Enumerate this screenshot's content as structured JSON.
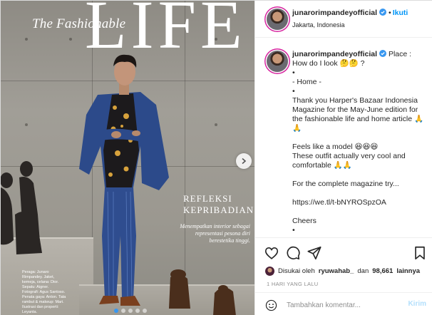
{
  "photo": {
    "magazine_script": "The Fashionable",
    "magazine_title": "LIFE",
    "feature_title": "REFLEKSI KEPRIBADIAN",
    "feature_subtitle": "Menempatkan interior sebagai representasi pesona diri berestetika tinggi.",
    "credits": "Peraga: Junaro Rimpandey. Jaket, kemeja, celana: Dior. Sepatu: Aigner. Fotografi: Agus Santoso. Penata gaya: Anton. Tata rambut & makeup: Mari. Ilustrasi dan properti: Leyanta.",
    "slide_count": 5,
    "active_slide": 1
  },
  "header": {
    "username": "junarorimpandeyofficial",
    "follow_label": "Ikuti",
    "location": "Jakarta, Indonesia",
    "separator": "•"
  },
  "caption": {
    "username": "junarorimpandeyofficial",
    "text": "Place : How do I look 🤔🤔 ?\n•\n- Home -\n•\nThank you Harper's Bazaar Indonesia Magazine for the May-June edition for the fashionable life and home article 🙏🙏\n\nFeels like a model 😆😆😆\nThese outfit actually very cool and comfortable 🙏🙏\n\nFor the complete magazine try...\n\nhttps://we.tl/t-bNYROSpzOA\n\nCheers\n•"
  },
  "engagement": {
    "liked_by_prefix": "Disukai oleh",
    "liked_by_user": "ryuwahab_",
    "liked_by_middle": "dan",
    "likes_count": "98,661",
    "liked_by_suffix": "lainnya",
    "time_ago": "1 HARI YANG LALU"
  },
  "comment": {
    "placeholder": "Tambahkan komentar...",
    "send_label": "Kirim"
  },
  "colors": {
    "accent": "#0095f6",
    "verified": "#3897f0",
    "send_disabled": "#b2dffc",
    "muted": "#8e8e8e"
  },
  "icons": [
    "chevron-right-icon",
    "verified-badge-icon",
    "heart-icon",
    "comment-icon",
    "share-icon",
    "bookmark-icon",
    "emoji-icon"
  ]
}
